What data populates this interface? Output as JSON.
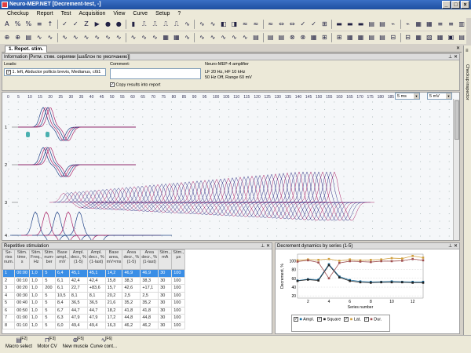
{
  "window": {
    "title": "Neuro-MEP.NET [Decrement-test, -]"
  },
  "menu": [
    "Checkup",
    "Report",
    "Test",
    "Acquisition",
    "View",
    "Curve",
    "Setup",
    "?"
  ],
  "toolbar1_icons": [
    "A",
    "%",
    "%",
    "≡",
    "↑",
    "✓",
    "✓",
    "Z",
    "▶",
    "●",
    "●",
    "▮",
    "⎍",
    "⎍",
    "⎍",
    "⎍",
    "∿",
    "∿",
    "∿",
    "◧",
    "◨",
    "≈",
    "≈",
    "≈",
    "⇔",
    "⇔",
    "✓",
    "✓",
    "⊞",
    "▬",
    "▬",
    "▬",
    "▤",
    "▤",
    "⌁",
    "⌁",
    "▦",
    "▦",
    "≡",
    "≡",
    "▥"
  ],
  "toolbar2_icons": [
    "⊕",
    "⊕",
    "▤",
    "∿",
    "∿",
    "∿",
    "∿",
    "∿",
    "∿",
    "∿",
    "∿",
    "∿",
    "∿",
    "∿",
    "▦",
    "▦",
    "∿",
    "∿",
    "∿",
    "∿",
    "∿",
    "∿",
    "▤",
    "▤",
    "▤",
    "⊗",
    "⊗",
    "▦",
    "⊞",
    "⊞",
    "▦",
    "▦",
    "▤",
    "▤",
    "⊟",
    "⊟",
    "▦",
    "▧",
    "▦",
    "▣",
    "▤"
  ],
  "tab": {
    "label": "1. Repet. stim."
  },
  "info": {
    "header": "Information [Ритм. стим. сериями [шаблон по умолчанию]]",
    "leads_label": "Leads:",
    "lead_item": "1. left, Abductor pollicis brevis, Medianus, c6t1",
    "comment_label": "Comment:",
    "copy_label": "Copy results into report",
    "amp_title": "Neuro-MEP-4 amplifier",
    "amp_line1": "LF  20 Hz,  HF  10 kHz",
    "amp_line2": "50 Hz  Off,  Range 60 mV"
  },
  "plot": {
    "scale_labels": [
      "0",
      "5",
      "10",
      "15",
      "20",
      "25",
      "30",
      "35",
      "40",
      "45",
      "50",
      "55",
      "60",
      "65",
      "70",
      "75",
      "80",
      "85",
      "90",
      "95",
      "100",
      "105",
      "110",
      "115",
      "120",
      "125",
      "130",
      "135",
      "140",
      "145",
      "150",
      "155",
      "160",
      "165",
      "170",
      "175",
      "180",
      "185"
    ],
    "time_select": "5 ms",
    "amp_select": "5 mV",
    "channel_labels": [
      "1",
      "2",
      "3",
      "4"
    ]
  },
  "sidebar": {
    "label": "Checkup inspector"
  },
  "rep": {
    "header": "Repetitive stimulation",
    "columns": [
      "Se-\nries\nnum.",
      "Stim.\ntime,\ns",
      "Stim.\nFreq.,\nHz",
      "Stim.\nnum-\nber",
      "Base\nampl.,\nmV",
      "Ampl.\ndecr., %\n(1-5)",
      "Ampl.\ndecr., %\n(1-last)",
      "Base\narea,\nmV×ms",
      "Area\ndecr., %\n(1-5)",
      "Area\ndecr., %\n(1-last)",
      "Stim.,\nmA",
      "Stim.,\nμs"
    ],
    "rows": [
      [
        "1",
        "00:00",
        "1,0",
        "5",
        "6,4",
        "45,1",
        "45,1",
        "14,2",
        "46,9",
        "46,9",
        "30",
        "100"
      ],
      [
        "2",
        "00:10",
        "1,0",
        "5",
        "6,1",
        "42,4",
        "42,4",
        "15,8",
        "38,3",
        "38,3",
        "30",
        "100"
      ],
      [
        "3",
        "00:20",
        "1,0",
        "200",
        "6,1",
        "22,7",
        "+83,6",
        "15,7",
        "42,6",
        "+17,1",
        "30",
        "100"
      ],
      [
        "4",
        "00:30",
        "1,0",
        "5",
        "10,5",
        "8,1",
        "8,1",
        "20,2",
        "2,5",
        "2,5",
        "30",
        "100"
      ],
      [
        "5",
        "00:40",
        "1,0",
        "5",
        "8,4",
        "36,5",
        "36,5",
        "21,6",
        "35,2",
        "35,2",
        "30",
        "100"
      ],
      [
        "6",
        "00:50",
        "1,0",
        "5",
        "6,7",
        "44,7",
        "44,7",
        "18,2",
        "41,8",
        "41,8",
        "30",
        "100"
      ],
      [
        "7",
        "01:00",
        "1,0",
        "5",
        "6,3",
        "47,9",
        "47,9",
        "17,2",
        "44,8",
        "44,8",
        "30",
        "100"
      ],
      [
        "8",
        "01:10",
        "1,0",
        "5",
        "6,0",
        "49,4",
        "49,4",
        "16,3",
        "46,2",
        "46,2",
        "30",
        "100"
      ]
    ]
  },
  "dyn": {
    "header": "Decrement dynamics by series (1-5)",
    "chart_data": {
      "type": "line",
      "title": "",
      "xlabel": "Series number",
      "ylabel": "Decrement, %",
      "xlim": [
        1,
        13
      ],
      "ylim": [
        15,
        115
      ],
      "x": [
        1,
        2,
        3,
        4,
        5,
        6,
        7,
        8,
        9,
        10,
        11,
        12,
        13
      ],
      "xticks": [
        2,
        4,
        6,
        8,
        10,
        12
      ],
      "yticks": [
        20,
        40,
        60,
        80,
        100
      ],
      "series": [
        {
          "name": "Ampl.",
          "color": "#1a6fa0",
          "values": [
            55,
            58,
            57,
            92,
            64,
            56,
            53,
            52,
            52,
            53,
            52,
            52,
            52
          ]
        },
        {
          "name": "Square",
          "color": "#222222",
          "values": [
            54,
            57,
            55,
            90,
            62,
            54,
            51,
            50,
            51,
            51,
            51,
            50,
            50
          ]
        },
        {
          "name": "Lat.",
          "color": "#d0a040",
          "values": [
            101,
            103,
            102,
            104,
            100,
            103,
            101,
            102,
            103,
            106,
            105,
            111,
            107
          ]
        },
        {
          "name": "Dur.",
          "color": "#a05050",
          "values": [
            98,
            101,
            96,
            60,
            95,
            99,
            98,
            97,
            99,
            99,
            100,
            104,
            101
          ]
        }
      ]
    }
  },
  "footer": [
    {
      "key": "[F2]",
      "label": "Macro select",
      "icon": "▤"
    },
    {
      "key": "[F3]",
      "label": "Motor CV",
      "icon": "⊓"
    },
    {
      "key": "[F5]",
      "label": "New muscle",
      "icon": "⊕"
    },
    {
      "key": "[F6]",
      "label": "Curve cont...",
      "icon": "∿"
    }
  ]
}
